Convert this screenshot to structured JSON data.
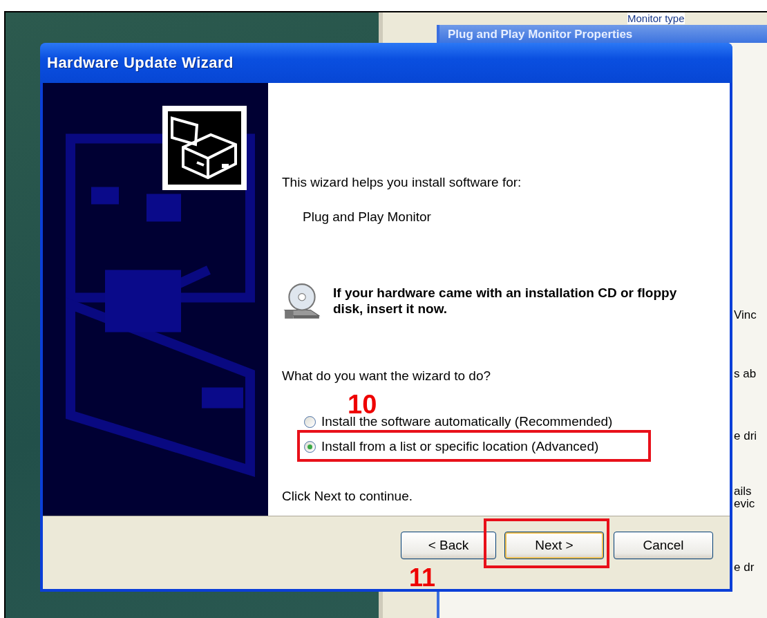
{
  "background_window": {
    "group_label": "Monitor type"
  },
  "properties_window": {
    "title": "Plug and Play Monitor Properties",
    "fragments": [
      "Vinc",
      "s ab",
      "e dri",
      "ails",
      "evic",
      "e dr"
    ]
  },
  "wizard": {
    "title": "Hardware Update Wizard",
    "intro": "This wizard helps you install software for:",
    "device": "Plug and Play Monitor",
    "cd_prompt": "If your hardware came with an installation CD or floppy disk, insert it now.",
    "question": "What do you want the wizard to do?",
    "options": [
      {
        "label": "Install the software automatically (Recommended)",
        "selected": false
      },
      {
        "label": "Install from a list or specific location (Advanced)",
        "selected": true
      }
    ],
    "hint": "Click Next to continue.",
    "buttons": [
      {
        "label": "< Back",
        "kind": "back"
      },
      {
        "label": "Next >",
        "kind": "default"
      },
      {
        "label": "Cancel",
        "kind": "cancel"
      }
    ]
  },
  "annotations": [
    {
      "label": "10"
    },
    {
      "label": "11"
    }
  ]
}
